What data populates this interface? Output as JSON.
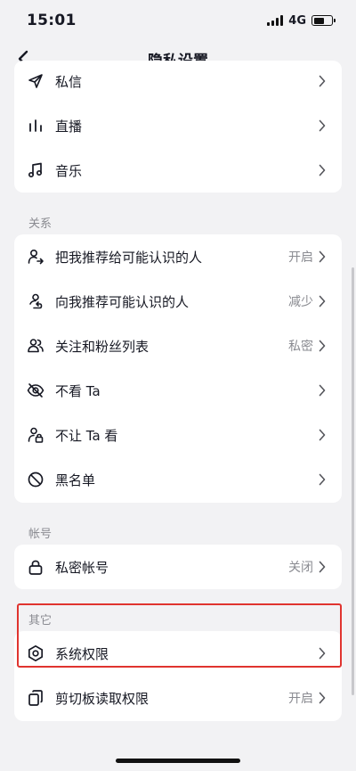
{
  "status_bar": {
    "time": "15:01",
    "network": "4G",
    "battery_level": 0.6
  },
  "nav": {
    "title": "隐私设置"
  },
  "card_top": {
    "items": [
      {
        "label": "私信",
        "icon": "send-icon"
      },
      {
        "label": "直播",
        "icon": "live-bars-icon"
      },
      {
        "label": "音乐",
        "icon": "music-note-icon"
      }
    ]
  },
  "sections": {
    "relations": {
      "label": "关系",
      "items": [
        {
          "label": "把我推荐给可能认识的人",
          "value": "开启",
          "icon": "user-share-icon"
        },
        {
          "label": "向我推荐可能认识的人",
          "value": "减少",
          "icon": "user-suggest-icon"
        },
        {
          "label": "关注和粉丝列表",
          "value": "私密",
          "icon": "users-icon"
        },
        {
          "label": "不看 Ta",
          "value": "",
          "icon": "eye-off-icon"
        },
        {
          "label": "不让 Ta 看",
          "value": "",
          "icon": "user-lock-icon"
        },
        {
          "label": "黑名单",
          "value": "",
          "icon": "block-icon"
        }
      ]
    },
    "account": {
      "label": "帐号",
      "items": [
        {
          "label": "私密帐号",
          "value": "关闭",
          "icon": "lock-icon"
        }
      ]
    },
    "other": {
      "label": "其它",
      "items": [
        {
          "label": "系统权限",
          "value": "",
          "icon": "hexagon-settings-icon"
        },
        {
          "label": "剪切板读取权限",
          "value": "开启",
          "icon": "clipboard-icon"
        }
      ]
    }
  },
  "colors": {
    "background": "#f2f2f4",
    "card": "#ffffff",
    "highlight": "#e0342f",
    "secondary_text": "#8a8b91"
  }
}
